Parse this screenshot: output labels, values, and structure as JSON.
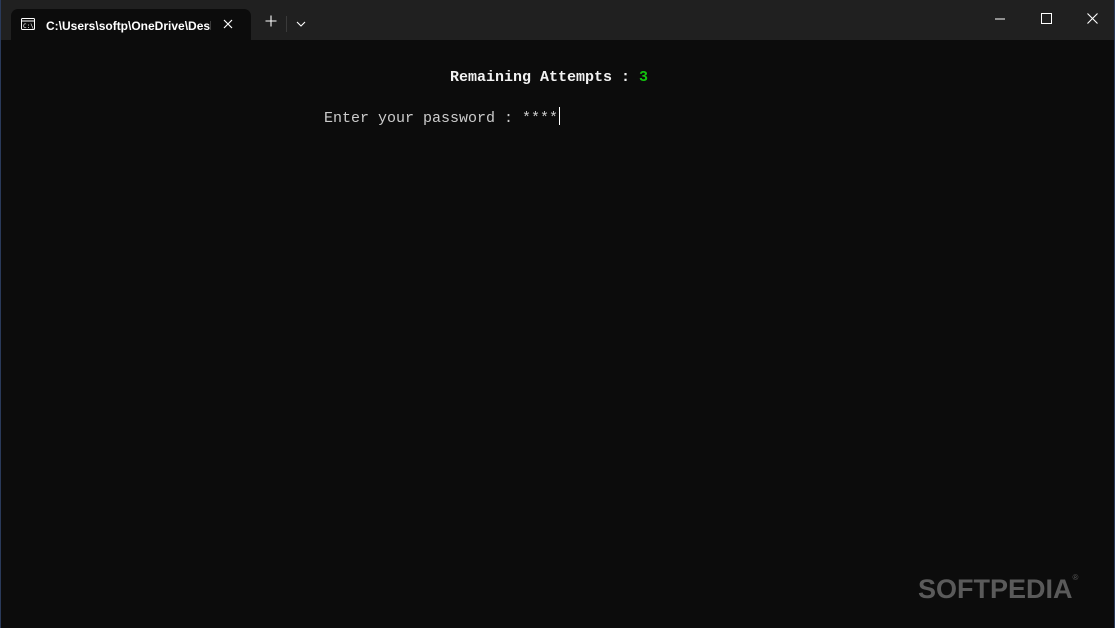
{
  "window": {
    "tab_title": "C:\\Users\\softp\\OneDrive\\Desktop\\Password.exe"
  },
  "icons": {
    "tab": "terminal-icon",
    "tab_close": "close-icon",
    "new_tab": "plus-icon",
    "dropdown": "chevron-down-icon",
    "minimize": "minimize-icon",
    "maximize": "maximize-icon",
    "close": "close-icon"
  },
  "terminal": {
    "attempts_label": "Remaining Attempts : ",
    "attempts_value": "3",
    "prompt_label": "Enter your password : ",
    "password_mask": "****"
  },
  "watermark": {
    "text": "SOFTPEDIA",
    "mark": "®"
  },
  "colors": {
    "background": "#0c0c0c",
    "titlebar": "#202020",
    "attempts_value": "#13c20e"
  }
}
